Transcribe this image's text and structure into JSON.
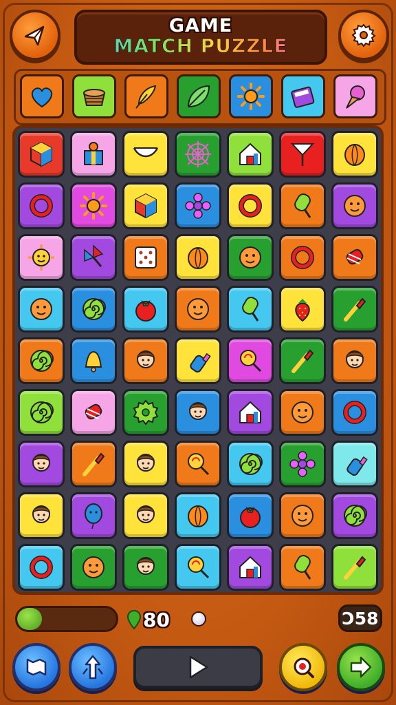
{
  "header": {
    "title_line1": "GAME",
    "title_line2": "MATCH PUZZLE"
  },
  "top_buttons": [
    "plane-icon",
    "gear-icon"
  ],
  "collection": [
    {
      "bg": "#f07a1a",
      "icon": "heart"
    },
    {
      "bg": "#8fe03a",
      "icon": "basket"
    },
    {
      "bg": "#f07a1a",
      "icon": "feather"
    },
    {
      "bg": "#28a030",
      "icon": "leaf"
    },
    {
      "bg": "#2b8fe0",
      "icon": "sun"
    },
    {
      "bg": "#45c8f0",
      "icon": "book"
    },
    {
      "bg": "#f6a6e6",
      "icon": "ice-cream"
    }
  ],
  "board": [
    [
      {
        "bg": "#e83a2a",
        "icon": "cube"
      },
      {
        "bg": "#f6a6e6",
        "icon": "gift"
      },
      {
        "bg": "#ffe23a",
        "icon": "hammock"
      },
      {
        "bg": "#28a030",
        "icon": "web"
      },
      {
        "bg": "#8fe03a",
        "icon": "house"
      },
      {
        "bg": "#e82020",
        "icon": "flag"
      },
      {
        "bg": "#ffe23a",
        "icon": "orange"
      }
    ],
    [
      {
        "bg": "#a24ae0",
        "icon": "ring"
      },
      {
        "bg": "#e04ae0",
        "icon": "sun"
      },
      {
        "bg": "#ffe23a",
        "icon": "cube"
      },
      {
        "bg": "#2b8fe0",
        "icon": "flower"
      },
      {
        "bg": "#ffe23a",
        "icon": "ring"
      },
      {
        "bg": "#f07a1a",
        "icon": "popsicle"
      },
      {
        "bg": "#a24ae0",
        "icon": "face"
      }
    ],
    [
      {
        "bg": "#f6a6e6",
        "icon": "sun-face"
      },
      {
        "bg": "#a24ae0",
        "icon": "pinwheel"
      },
      {
        "bg": "#f07a1a",
        "icon": "dice"
      },
      {
        "bg": "#ffe23a",
        "icon": "orange"
      },
      {
        "bg": "#28a030",
        "icon": "face"
      },
      {
        "bg": "#f07a1a",
        "icon": "ring"
      },
      {
        "bg": "#f07a1a",
        "icon": "candy"
      }
    ],
    [
      {
        "bg": "#45c8f0",
        "icon": "face"
      },
      {
        "bg": "#2b8fe0",
        "icon": "spiral"
      },
      {
        "bg": "#45c8f0",
        "icon": "tomato"
      },
      {
        "bg": "#f07a1a",
        "icon": "face"
      },
      {
        "bg": "#45c8f0",
        "icon": "popsicle"
      },
      {
        "bg": "#ffe23a",
        "icon": "strawberry"
      },
      {
        "bg": "#28a030",
        "icon": "brush"
      }
    ],
    [
      {
        "bg": "#f07a1a",
        "icon": "spiral"
      },
      {
        "bg": "#2b8fe0",
        "icon": "bell"
      },
      {
        "bg": "#f07a1a",
        "icon": "person"
      },
      {
        "bg": "#ffe23a",
        "icon": "bottle"
      },
      {
        "bg": "#e04ae0",
        "icon": "lollipop"
      },
      {
        "bg": "#28a030",
        "icon": "brush"
      },
      {
        "bg": "#f07a1a",
        "icon": "person"
      }
    ],
    [
      {
        "bg": "#8fe03a",
        "icon": "spiral"
      },
      {
        "bg": "#f6a6e6",
        "icon": "candy"
      },
      {
        "bg": "#28a030",
        "icon": "gear"
      },
      {
        "bg": "#2b8fe0",
        "icon": "person"
      },
      {
        "bg": "#a24ae0",
        "icon": "house"
      },
      {
        "bg": "#f07a1a",
        "icon": "face"
      },
      {
        "bg": "#2b8fe0",
        "icon": "ring"
      }
    ],
    [
      {
        "bg": "#a24ae0",
        "icon": "person"
      },
      {
        "bg": "#f07a1a",
        "icon": "brush"
      },
      {
        "bg": "#ffe23a",
        "icon": "person"
      },
      {
        "bg": "#f07a1a",
        "icon": "lollipop"
      },
      {
        "bg": "#45c8f0",
        "icon": "spiral"
      },
      {
        "bg": "#28a030",
        "icon": "flower"
      },
      {
        "bg": "#7fe8ea",
        "icon": "bottle"
      }
    ],
    [
      {
        "bg": "#ffe23a",
        "icon": "person"
      },
      {
        "bg": "#a24ae0",
        "icon": "balloon"
      },
      {
        "bg": "#ffe23a",
        "icon": "person"
      },
      {
        "bg": "#45c8f0",
        "icon": "orange"
      },
      {
        "bg": "#2b8fe0",
        "icon": "tomato"
      },
      {
        "bg": "#f07a1a",
        "icon": "face"
      },
      {
        "bg": "#a24ae0",
        "icon": "spiral"
      }
    ],
    [
      {
        "bg": "#45c8f0",
        "icon": "ring"
      },
      {
        "bg": "#28a030",
        "icon": "face"
      },
      {
        "bg": "#28a030",
        "icon": "person"
      },
      {
        "bg": "#45c8f0",
        "icon": "lollipop"
      },
      {
        "bg": "#a24ae0",
        "icon": "house"
      },
      {
        "bg": "#f07a1a",
        "icon": "popsicle"
      },
      {
        "bg": "#8fe03a",
        "icon": "brush"
      }
    ]
  ],
  "status": {
    "progress": 0.25,
    "score": "80",
    "moves": "Ɔ58"
  },
  "bottom_buttons": [
    "map-icon",
    "arrows-icon",
    "play-icon",
    "search-icon",
    "next-icon"
  ]
}
